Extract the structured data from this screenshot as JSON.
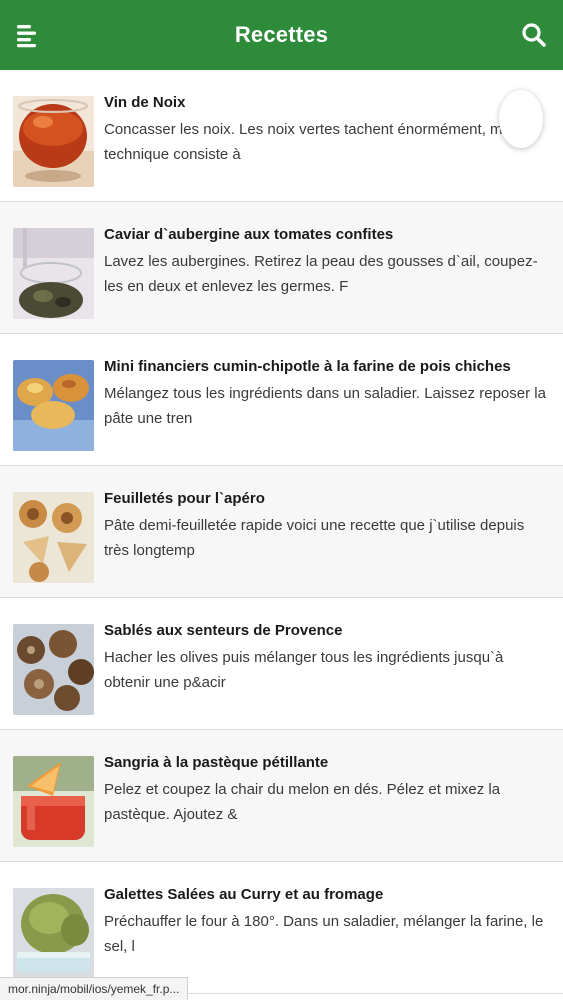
{
  "header": {
    "title": "Recettes",
    "menu_icon": "hamburger-menu-icon",
    "search_icon": "search-icon",
    "color": "#2e8b3a"
  },
  "recipes": [
    {
      "title": "Vin de Noix",
      "description": "Concasser les noix. Les noix vertes tachent énormément, ma technique consiste à",
      "image": "wine-glass-image"
    },
    {
      "title": "Caviar d`aubergine aux tomates confites",
      "description": "Lavez les aubergines. Retirez la peau des gousses d`ail, coupez-les en deux et enlevez les germes. F",
      "image": "eggplant-caviar-image"
    },
    {
      "title": "Mini financiers cumin-chipotle à la farine de pois chiches",
      "description": "Mélangez tous les ingrédients dans un saladier. Laissez reposer la pâte une tren",
      "image": "financiers-image"
    },
    {
      "title": "Feuilletés pour l`apéro",
      "description": "Pâte demi-feuilletée rapide voici une recette que j`utilise depuis très longtemp",
      "image": "puff-pastry-image"
    },
    {
      "title": "Sablés aux senteurs de Provence",
      "description": "Hacher les olives puis mélanger tous les ingrédients jusqu`à obtenir une p&acir",
      "image": "shortbread-image"
    },
    {
      "title": "Sangria à la pastèque pétillante",
      "description": "Pelez et coupez la chair du melon en dés. Pélez et mixez la pastèque. Ajoutez &",
      "image": "sangria-image"
    },
    {
      "title": "Galettes Salées au Curry et au fromage",
      "description": "Préchauffer le four à 180°. Dans un saladier, mélanger la farine, le sel, l",
      "image": "galettes-image"
    }
  ],
  "status_url": "mor.ninja/mobil/ios/yemek_fr.p..."
}
